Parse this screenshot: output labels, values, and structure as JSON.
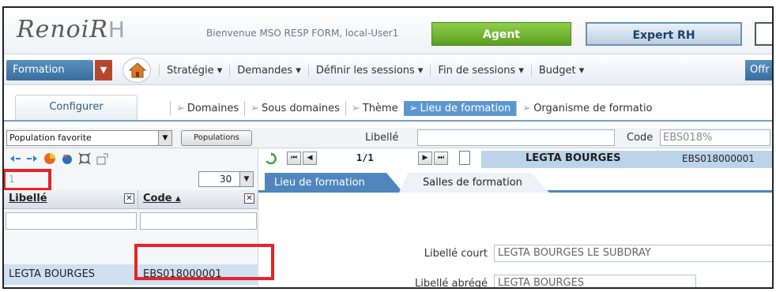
{
  "header": {
    "logo_main": "RenoiR",
    "logo_suffix": "H",
    "welcome": "Bienvenue MSO RESP FORM, local-User1",
    "agent_label": "Agent",
    "expert_label": "Expert RH"
  },
  "menu": {
    "module": "Formation",
    "items": [
      "Stratégie ▾",
      "Demandes ▾",
      "Définir les sessions ▾",
      "Fin de sessions ▾",
      "Budget ▾"
    ],
    "overflow": "Offr"
  },
  "tabs": {
    "configure": "Configurer",
    "sub": [
      "Domaines",
      "Sous domaines",
      "Thème",
      "Lieu de formation",
      "Organisme de formatio"
    ],
    "active_index": 3
  },
  "filters": {
    "population": "Population favorite",
    "populations_button": "Populations",
    "libelle_label": "Libellé",
    "libelle_value": "",
    "code_label": "Code",
    "code_value": "EBS018%"
  },
  "list": {
    "page": "1",
    "per_page": "30",
    "col_libelle": "Libellé",
    "col_code": "Code ▴",
    "rows": [
      {
        "libelle": "LEGTA BOURGES",
        "code": "EBS018000001"
      }
    ]
  },
  "record": {
    "position": "1/1",
    "title": "LEGTA BOURGES",
    "code": "EBS018000001",
    "tab_active": "Lieu de formation",
    "tab_other": "Salles de formation",
    "fields": {
      "libelle_court_label": "Libellé court",
      "libelle_court_value": "LEGTA BOURGES LE SUBDRAY",
      "libelle_abrege_label": "Libellé abrégé",
      "libelle_abrege_value": "LEGTA BOURGES"
    }
  },
  "colors": {
    "accent": "#4f86bd",
    "agent_green": "#5b9f22",
    "highlight_red": "#e8232a"
  }
}
